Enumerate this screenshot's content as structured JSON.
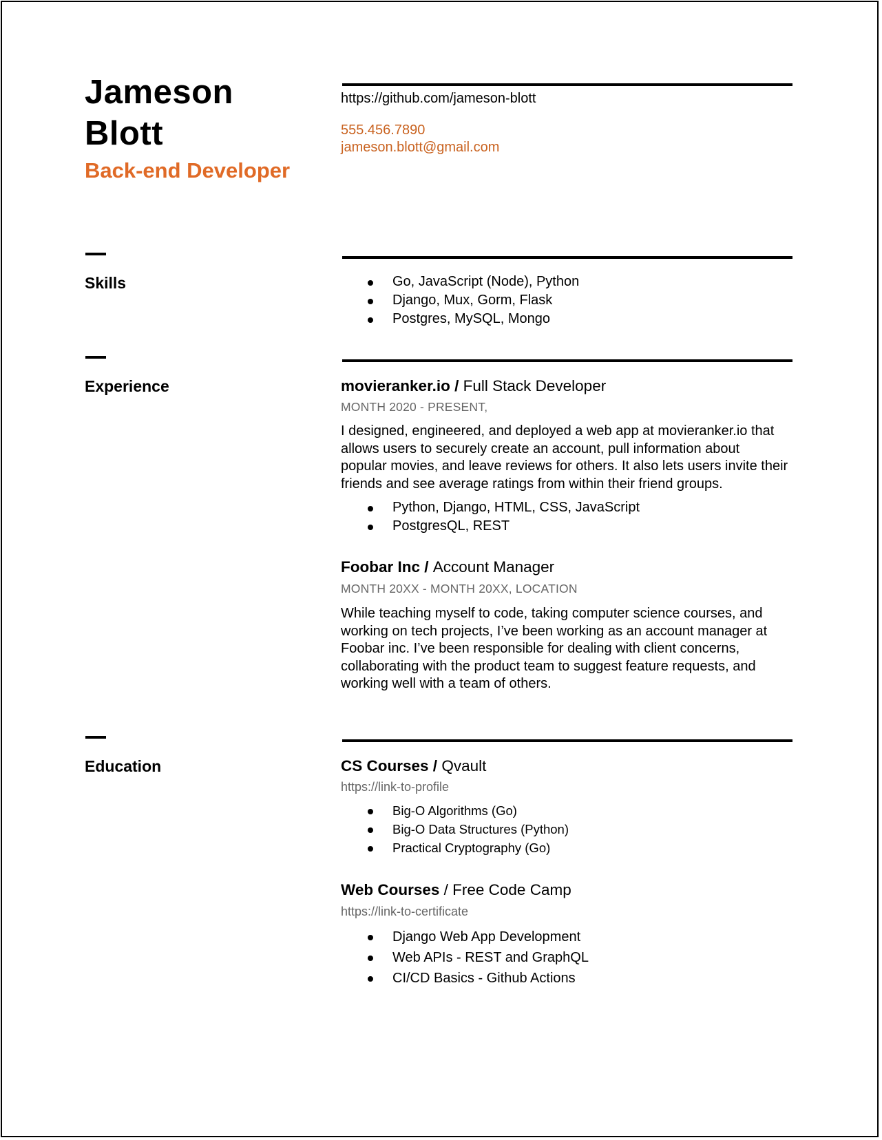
{
  "header": {
    "first_name": "Jameson",
    "last_name": "Blott",
    "role": "Back-end Developer",
    "github": "https://github.com/jameson-blott",
    "phone": "555.456.7890",
    "email": "jameson.blott@gmail.com",
    "accent_color": "#e06a26"
  },
  "skills": {
    "label": "Skills",
    "items": [
      "Go, JavaScript (Node), Python",
      "Django, Mux, Gorm, Flask",
      "Postgres, MySQL, Mongo"
    ]
  },
  "experience": {
    "label": "Experience",
    "jobs": [
      {
        "company": "movieranker.io",
        "separator": " / ",
        "title": "Full Stack Developer",
        "dates": "MONTH 2020 - PRESENT,",
        "lines": [
          "I designed, engineered, and deployed a web app at movieranker.io that",
          "allows users to securely create an account, pull information about",
          "popular movies, and leave reviews for others. It also lets users invite their",
          "friends and see average ratings from within their friend groups."
        ],
        "bullets": [
          "Python, Django, HTML, CSS, JavaScript",
          "PostgresQL, REST"
        ]
      },
      {
        "company": "Foobar Inc",
        "separator": " / ",
        "title": "Account Manager",
        "dates": "MONTH 20XX - MONTH 20XX,  LOCATION",
        "lines": [
          "While teaching myself to code, taking computer science courses, and",
          "working on tech projects, I’ve been working as an account manager at",
          "Foobar inc. I’ve been responsible for dealing with client concerns,",
          "collaborating with the product team to suggest feature requests, and",
          "working well with a team of others."
        ]
      }
    ]
  },
  "education": {
    "label": "Education",
    "entries": [
      {
        "name": "CS Courses",
        "separator": " / ",
        "provider": "Qvault",
        "link": "https://link-to-profile",
        "bullets": [
          "Big-O Algorithms (Go)",
          "Big-O Data Structures (Python)",
          "Practical Cryptography (Go)"
        ]
      },
      {
        "name": "Web Courses",
        "separator": " / ",
        "provider": "Free Code Camp",
        "link": "https://link-to-certificate",
        "bullets": [
          "Django Web App Development",
          "Web APIs - REST and GraphQL",
          "CI/CD Basics - Github Actions"
        ]
      }
    ]
  }
}
